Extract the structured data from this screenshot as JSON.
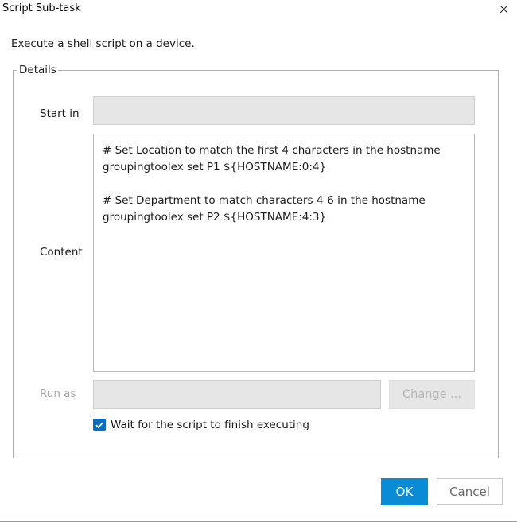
{
  "window": {
    "title": "Script Sub-task",
    "close_icon": "close-icon"
  },
  "description": "Execute a shell script on a device.",
  "details": {
    "legend": "Details",
    "start_in": {
      "label": "Start in",
      "value": ""
    },
    "content": {
      "label": "Content",
      "value": "# Set Location to match the first 4 characters in the hostname\ngroupingtoolex set P1 ${HOSTNAME:0:4}\n\n# Set Department to match characters 4-6 in the hostname\ngroupingtoolex set P2 ${HOSTNAME:4:3}"
    },
    "run_as": {
      "label": "Run as",
      "value": "",
      "change_label": "Change ..."
    },
    "wait_checkbox": {
      "label": "Wait for the script to finish executing",
      "checked": true
    }
  },
  "buttons": {
    "ok": "OK",
    "cancel": "Cancel"
  },
  "colors": {
    "accent": "#0a8bd6",
    "checkbox": "#0a6ebd",
    "disabled_field": "#e6e6e6"
  }
}
